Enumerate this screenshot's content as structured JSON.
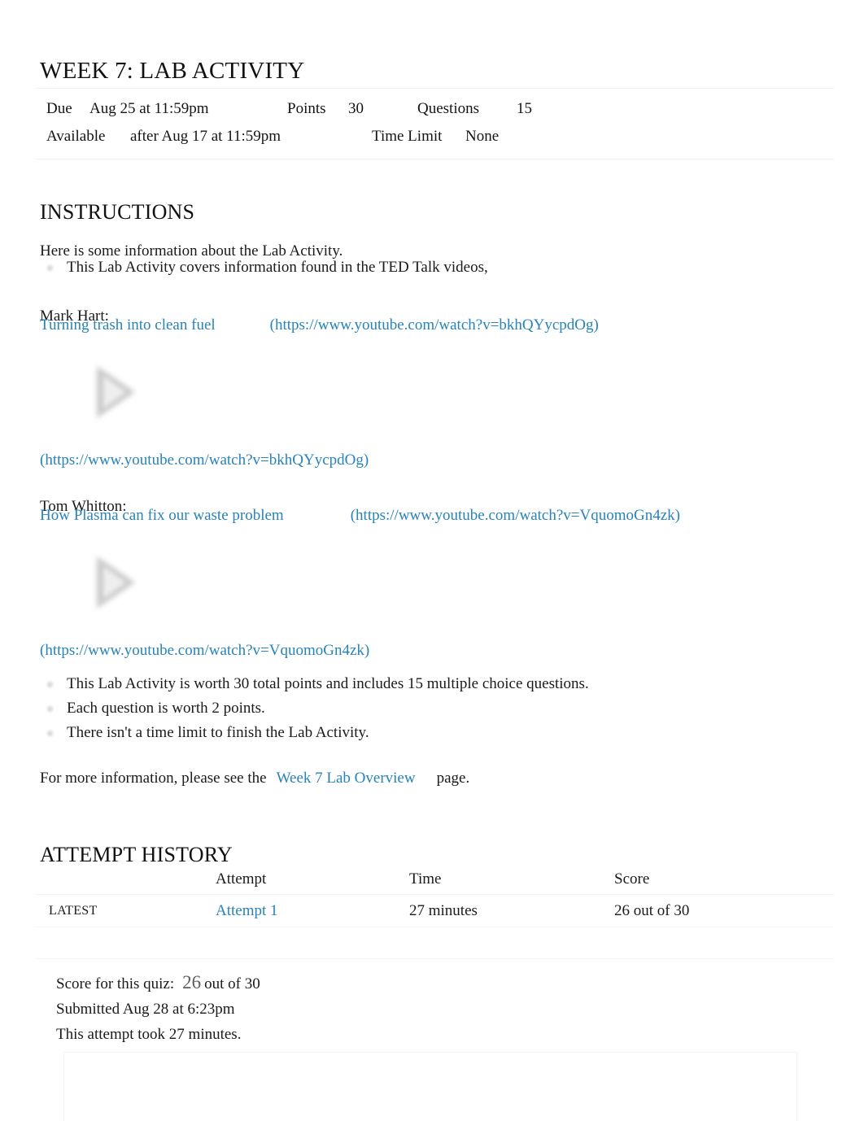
{
  "page": {
    "title": "WEEK 7: LAB ACTIVITY"
  },
  "info": {
    "due_label": "Due",
    "due_value": "Aug 25 at 11:59pm",
    "points_label": "Points",
    "points_value": "30",
    "questions_label": "Questions",
    "questions_value": "15",
    "available_label": "Available",
    "available_value": "after Aug 17 at 11:59pm",
    "time_limit_label": "Time Limit",
    "time_limit_value": "None"
  },
  "instructions": {
    "heading": "INSTRUCTIONS",
    "intro": "Here is some information about the Lab Activity.",
    "bullet_ted": "This Lab Activity covers information found in the TED Talk videos,",
    "speaker_one": "Mark Hart:",
    "video_one_title": "Turning trash into clean fuel",
    "video_one_url": "(https://www.youtube.com/watch?v=bkhQYycpdOg)",
    "video_one_url_below": "(https://www.youtube.com/watch?v=bkhQYycpdOg)",
    "speaker_two": "Tom Whitton:",
    "video_two_title": "How Plasma can fix our waste problem",
    "video_two_url": "(https://www.youtube.com/watch?v=VquomoGn4zk)",
    "video_two_url_below": "(https://www.youtube.com/watch?v=VquomoGn4zk)",
    "bullet_points": "This Lab Activity is worth 30 total points and includes 15 multiple choice questions.",
    "bullet_each": "Each question is worth 2 points.",
    "bullet_notime": "There isn't a time limit to finish the Lab Activity.",
    "more_info_prefix": "For more information, please see the",
    "more_info_link": "Week 7 Lab Overview",
    "more_info_suffix": "page."
  },
  "attempt_history": {
    "heading": "ATTEMPT HISTORY",
    "columns": {
      "kept": "",
      "attempt": "Attempt",
      "time": "Time",
      "score": "Score"
    },
    "rows": [
      {
        "kept": "LATEST",
        "attempt": "Attempt 1",
        "time": "27 minutes",
        "score": "26 out of 30"
      }
    ]
  },
  "score_summary": {
    "score_label": "Score for this quiz:",
    "score_number": "26",
    "score_suffix": "out of 30",
    "submitted": "Submitted Aug 28 at 6:23pm",
    "duration": "This attempt took 27 minutes."
  },
  "colors": {
    "link": "#2783b8",
    "text": "#1a1a1a",
    "rule": "#f1f2f3",
    "score_number": "#5e5e5e"
  },
  "icons": {
    "play": "play-icon",
    "bullet": "bullet-dot-icon"
  }
}
